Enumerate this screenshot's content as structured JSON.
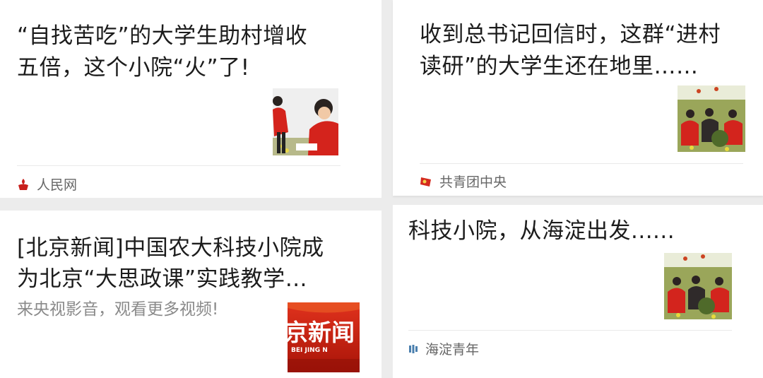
{
  "cards": [
    {
      "title_line1": "“自找苦吃”的大学生助村增收",
      "title_line2": "五倍，这个小院“火”了!",
      "source": "人民网",
      "source_icon": "people-daily-logo-icon",
      "thumb": "students-in-red-jackets-field-photo"
    },
    {
      "title_line1": "收到总书记回信时，这群“进村",
      "title_line2": "读研”的大学生还在地里……",
      "source": "共青团中央",
      "source_icon": "youth-league-flag-icon",
      "thumb": "students-in-field-photo"
    },
    {
      "title_line1": "[北京新闻]中国农大科技小院成",
      "title_line2": "为北京“大思政课”实践教学…",
      "subtitle": "来央视影音，观看更多视频!",
      "thumb_text_main": "京新闻",
      "thumb_text_sub": "BEI JING N",
      "thumb": "beijing-news-video-banner"
    },
    {
      "title_line1": "科技小院，从海淀出发......",
      "source": "海淀青年",
      "source_icon": "haidian-youth-logo-icon",
      "thumb": "students-in-field-photo"
    }
  ],
  "colors": {
    "title": "#1c1c1c",
    "source": "#666666",
    "subtitle": "#8a8a8a",
    "people_daily_red": "#c8201d",
    "youth_league_red": "#d42a1e",
    "banner_red": "#c21f12"
  }
}
